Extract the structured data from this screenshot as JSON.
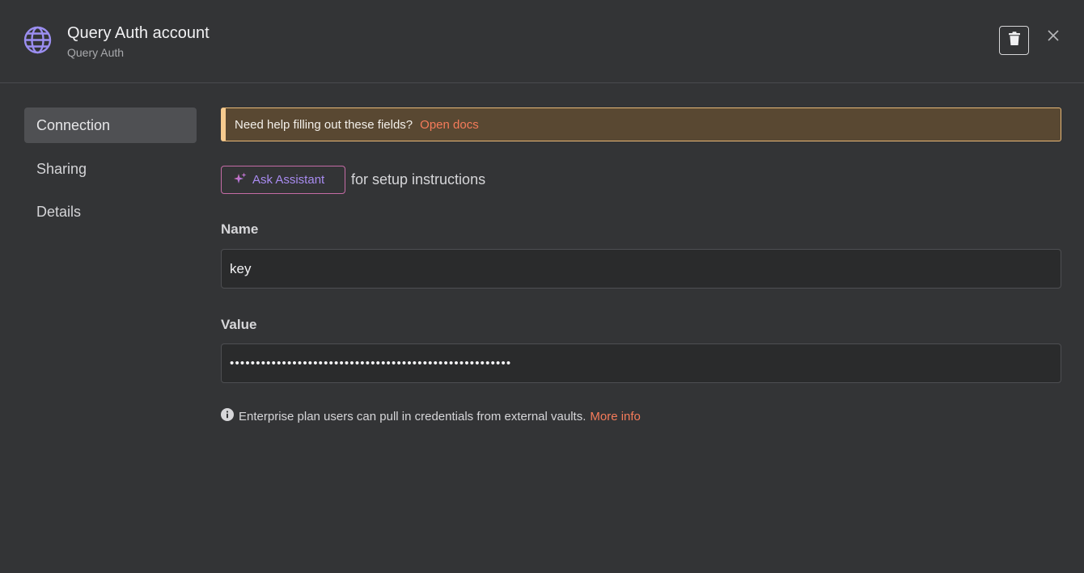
{
  "header": {
    "title": "Query Auth account",
    "subtitle": "Query Auth",
    "icon": "globe-icon"
  },
  "sidebar": {
    "items": [
      {
        "label": "Connection",
        "active": true
      },
      {
        "label": "Sharing",
        "active": false
      },
      {
        "label": "Details",
        "active": false
      }
    ]
  },
  "banner": {
    "text": "Need help filling out these fields?",
    "link": "Open docs"
  },
  "assistant": {
    "button_label": "Ask Assistant",
    "suffix": "for setup instructions"
  },
  "fields": {
    "name": {
      "label": "Name",
      "value": "key"
    },
    "value": {
      "label": "Value",
      "value": "••••••••••••••••••••••••••••••••••••••••••••••••••••••"
    }
  },
  "info": {
    "text": "Enterprise plan users can pull in credentials from external vaults.",
    "link": "More info"
  },
  "colors": {
    "background": "#333436",
    "accent_link": "#f57b5a",
    "banner_bg": "#594832",
    "banner_border": "#f6cb8f",
    "globe": "#9b8ef0"
  }
}
